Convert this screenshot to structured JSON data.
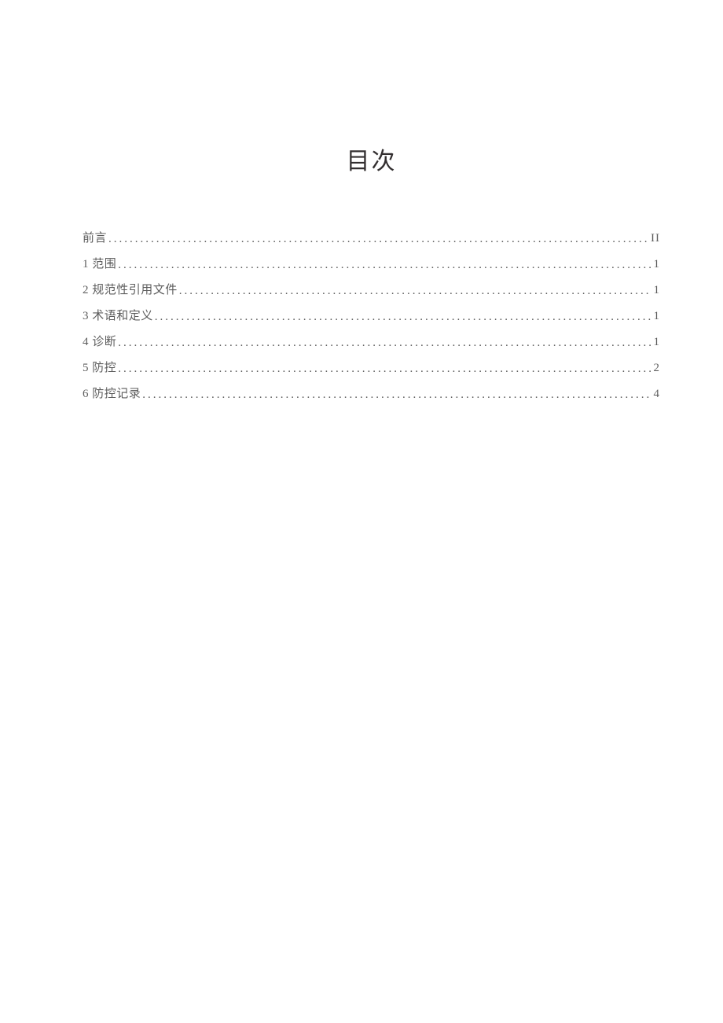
{
  "title": "目次",
  "toc": [
    {
      "label": "前言",
      "page": "II"
    },
    {
      "label": "1 范围",
      "page": "1"
    },
    {
      "label": "2 规范性引用文件",
      "page": "1"
    },
    {
      "label": "3 术语和定义",
      "page": "1"
    },
    {
      "label": "4 诊断",
      "page": "1"
    },
    {
      "label": "5 防控",
      "page": "2"
    },
    {
      "label": "6 防控记录",
      "page": "4"
    }
  ]
}
